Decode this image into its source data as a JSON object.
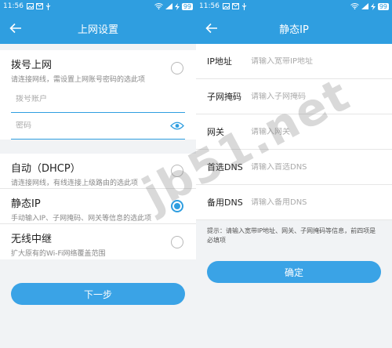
{
  "left": {
    "status": {
      "time": "11:56",
      "battery": "99"
    },
    "title": "上网设置",
    "options": [
      {
        "title": "拨号上网",
        "desc": "请连接网线，需设置上网账号密码的选此项",
        "checked": false
      },
      {
        "title": "自动（DHCP）",
        "desc": "请连接网线，有线连接上级路由的选此项",
        "checked": false
      },
      {
        "title": "静态IP",
        "desc": "手动输入IP、子网掩码、网关等信息的选此项",
        "checked": true
      },
      {
        "title": "无线中继",
        "desc": "扩大原有的Wi-Fi网络覆盖范围",
        "checked": false
      }
    ],
    "account_placeholder": "拨号账户",
    "password_placeholder": "密码",
    "next_label": "下一步"
  },
  "right": {
    "status": {
      "time": "11:56",
      "battery": "99"
    },
    "title": "静态IP",
    "rows": [
      {
        "label": "IP地址",
        "placeholder": "请输入宽带IP地址"
      },
      {
        "label": "子网掩码",
        "placeholder": "请输入子网掩码"
      },
      {
        "label": "网关",
        "placeholder": "请输入网关"
      },
      {
        "label": "首选DNS",
        "placeholder": "请输入首选DNS"
      },
      {
        "label": "备用DNS",
        "placeholder": "请输入备用DNS"
      }
    ],
    "hint": "提示：请输入宽带IP地址、网关、子网掩码等信息，前四项是必填项",
    "confirm_label": "确定"
  },
  "watermark": "jb51.net",
  "colors": {
    "accent": "#2f9ee0",
    "background": "#f1f3f5"
  }
}
